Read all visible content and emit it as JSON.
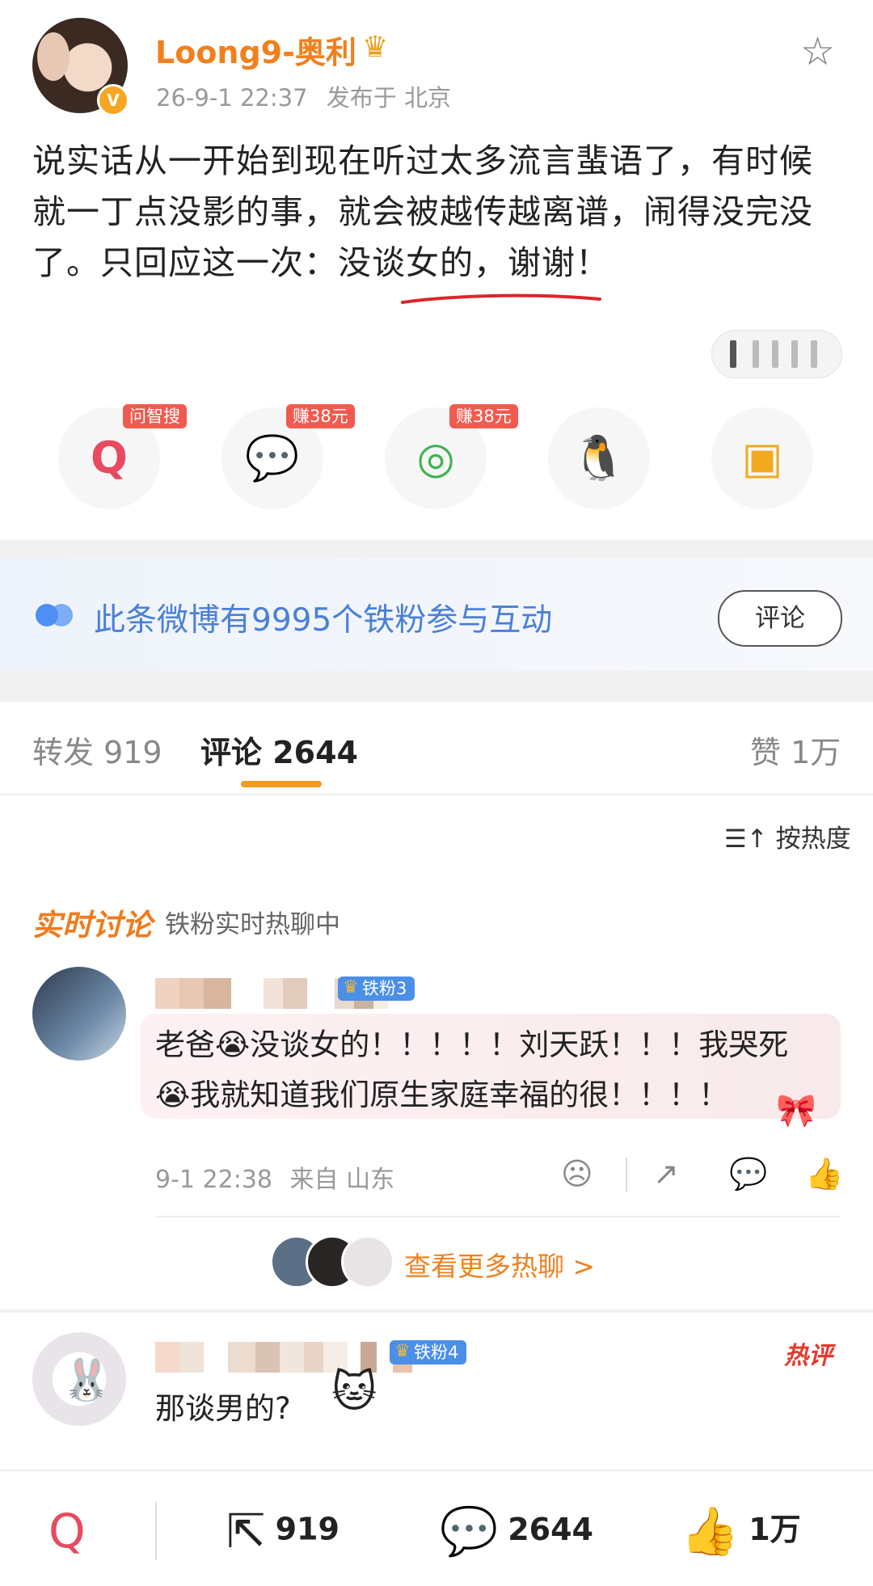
{
  "post": {
    "username": "Loong9-奥利",
    "verified_badge": "V",
    "time": "26-9-1 22:37",
    "location": "发布于 北京",
    "text": "说实话从一开始到现在听过太多流言蜚语了，有时候就一丁点没影的事，就会被越传越离谱，闹得没完没了。只回应这一次：没谈女的，谢谢！",
    "underline_color": "#d9262c"
  },
  "share": [
    {
      "name": "search",
      "tag": "问智搜",
      "icon": "Q"
    },
    {
      "name": "wechat",
      "tag": "赚38元",
      "icon": "💬"
    },
    {
      "name": "moments",
      "tag": "赚38元",
      "icon": "◎"
    },
    {
      "name": "qq",
      "tag": "",
      "icon": "🐧"
    },
    {
      "name": "save-image",
      "tag": "",
      "icon": "▣"
    }
  ],
  "fans_banner": {
    "text": "此条微博有9995个铁粉参与互动",
    "button": "评论"
  },
  "tabs": {
    "repost": "转发 919",
    "comments": "评论 2644",
    "likes": "赞 1万"
  },
  "sort_label": "按热度",
  "live": {
    "title": "实时讨论",
    "subtitle": "铁粉实时热聊中",
    "comment": {
      "badge": "铁粉3",
      "line1": "老爸😭没谈女的！！！！！刘天跃！！！我哭死",
      "line2": "😭我就知道我们原生家庭幸福的很！！！！",
      "time": "9-1 22:38",
      "location": "来自 山东"
    },
    "more_link": "查看更多热聊 >"
  },
  "hot_comment": {
    "badge": "铁粉4",
    "tag": "热评",
    "text": "那谈男的?"
  },
  "bottom_bar": {
    "repost_count": "919",
    "comment_count": "2644",
    "like_count": "1万"
  },
  "colors": {
    "accent_orange": "#f0801e",
    "link_blue": "#4a80d8",
    "tag_red": "#f15a4f"
  }
}
